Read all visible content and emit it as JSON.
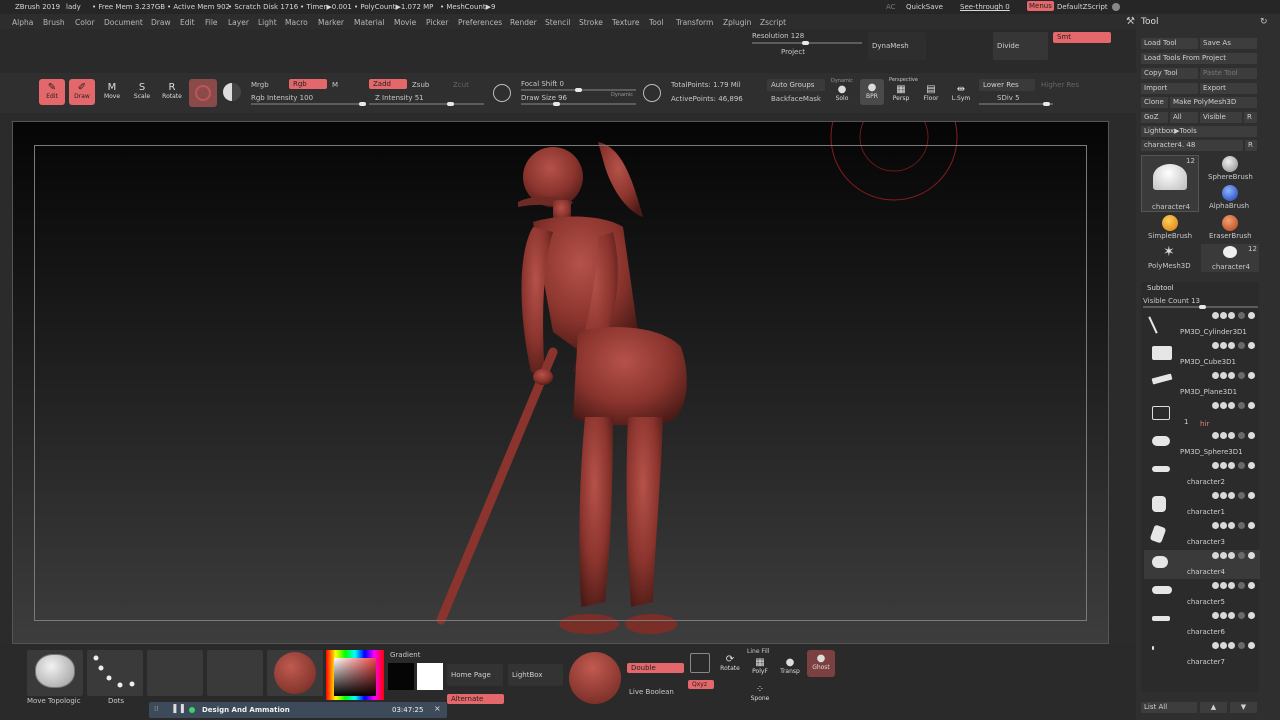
{
  "titlebar": {
    "app": "ZBrush 2019",
    "doc": "lady",
    "free_mem": "• Free Mem 3.237GB",
    "active_mem": "• Active Mem 902",
    "scratch": "• Scratch Disk 1716",
    "timer": "• Timer▶0.001",
    "polycount": "• PolyCount▶1.072 MP",
    "meshcount": "• MeshCount▶9",
    "ac": "AC",
    "quicksave": "QuickSave",
    "seethrough": "See-through 0",
    "menus": "Menus",
    "script": "DefaultZScript"
  },
  "menu": [
    "Alpha",
    "Brush",
    "Color",
    "Document",
    "Draw",
    "Edit",
    "File",
    "Layer",
    "Light",
    "Macro",
    "Marker",
    "Material",
    "Movie",
    "Picker",
    "Preferences",
    "Render",
    "Stencil",
    "Stroke",
    "Texture",
    "Tool",
    "Transform",
    "Zplugin",
    "Zscript"
  ],
  "geometry": {
    "resolution": "Resolution 128",
    "project": "Project",
    "dynamesh": "DynaMesh",
    "divide": "Divide",
    "smt": "Smt"
  },
  "shelf": {
    "edit": "Edit",
    "draw": "Draw",
    "move": "Move",
    "scale": "Scale",
    "rotate": "Rotate",
    "mrgb": "Mrgb",
    "rgb": "Rgb",
    "m": "M",
    "rgb_intensity": "Rgb Intensity 100",
    "zadd": "Zadd",
    "zsub": "Zsub",
    "zcut": "Zcut",
    "z_intensity": "Z Intensity 51",
    "focal_shift": "Focal Shift 0",
    "draw_size": "Draw Size 96",
    "dynamic": "Dynamic",
    "total_points": "TotalPoints: 1.79 Mil",
    "active_points": "ActivePoints: 46,896",
    "auto_groups": "Auto Groups",
    "backface_mask": "BackfaceMask",
    "dynamic2": "Dynamic",
    "solo": "Solo",
    "bpr": "BPR",
    "perspective": "Perspective",
    "persp": "Persp",
    "floor": "Floor",
    "lsym": "L.Sym",
    "lower_res": "Lower Res",
    "higher_res": "Higher Res",
    "sdiv": "SDiv 5"
  },
  "bottom": {
    "move_topo": "Move Topologic",
    "dots": "Dots",
    "gradient": "Gradient",
    "home_page": "Home Page",
    "lightbox": "LightBox",
    "double": "Double",
    "live_boolean": "Live Boolean",
    "alternate": "Alternate",
    "rotate": "Rotate",
    "polyf": "PolyF",
    "transp": "Transp",
    "ghost": "Ghost",
    "xyz": "Qxyz",
    "lineFill": "Line Fill",
    "spotlight": "Spone"
  },
  "media": {
    "title": "Design And Ammation",
    "time": "03:47:25"
  },
  "tool": {
    "header": "Tool",
    "load_tool": "Load Tool",
    "save_as": "Save As",
    "load_from_project": "Load Tools From Project",
    "copy_tool": "Copy Tool",
    "paste_tool": "Paste Tool",
    "import": "Import",
    "export": "Export",
    "clone": "Clone",
    "make_polymesh": "Make PolyMesh3D",
    "goz": "GoZ",
    "all": "All",
    "visible": "Visible",
    "r": "R",
    "lightbox_tools": "Lightbox▶Tools",
    "character_slider": "character4. 48",
    "brushes": [
      {
        "name": "character4",
        "count": "12"
      },
      {
        "name": "SphereBrush",
        "count": ""
      },
      {
        "name": "AlphaBrush",
        "count": ""
      },
      {
        "name": "SimpleBrush",
        "count": ""
      },
      {
        "name": "EraserBrush",
        "count": ""
      },
      {
        "name": "PolyMesh3D",
        "count": ""
      },
      {
        "name": "character4",
        "count": "12"
      }
    ]
  },
  "subtool": {
    "header": "Subtool",
    "visible_count": "Visible Count 13",
    "items": [
      "PM3D_Cylinder3D1",
      "PM3D_Cube3D1",
      "PM3D_Plane3D1",
      "1",
      "PM3D_Sphere3D1",
      "character2",
      "character1",
      "character3",
      "character4",
      "character5",
      "character6",
      "character7"
    ],
    "folder_label": "hir",
    "list_all": "List All"
  },
  "colors": {
    "accent": "#e4686b",
    "model": "#8e3a33",
    "bg": "#2b2b2b"
  }
}
